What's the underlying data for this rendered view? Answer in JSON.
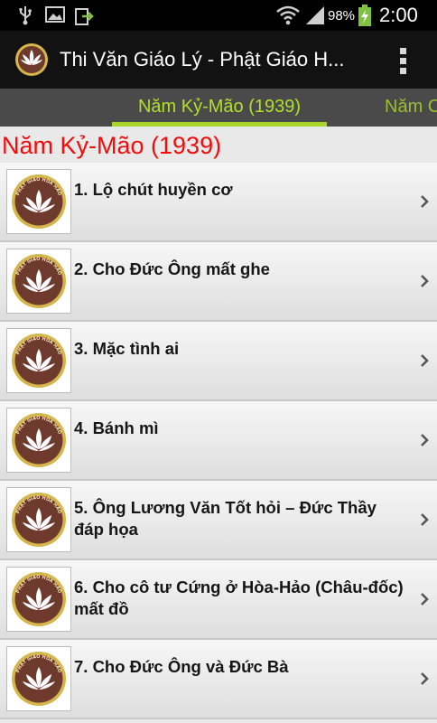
{
  "status_bar": {
    "battery_percent": "98%",
    "time": "2:00"
  },
  "action_bar": {
    "title": "Thi Văn Giáo Lý - Phật Giáo H...",
    "overflow_icon": "overflow-menu-icon"
  },
  "tabs": [
    {
      "label": "Năm Kỷ-Mão (1939)"
    },
    {
      "label": "Năm C"
    }
  ],
  "section": {
    "heading": "Năm Kỷ-Mão (1939)"
  },
  "logo_text": "PHẬT GIÁO HÒA HẢO",
  "items": [
    {
      "title": "1. Lộ chút huyền cơ"
    },
    {
      "title": "2. Cho Đức Ông mất ghe"
    },
    {
      "title": "3. Mặc tình ai"
    },
    {
      "title": "4. Bánh mì"
    },
    {
      "title": "5. Ông Lương Văn Tốt hỏi – Đức Thầy đáp họa"
    },
    {
      "title": "6. Cho cô tư Cứng ở Hòa-Hảo (Châu-đốc) mất đồ"
    },
    {
      "title": "7. Cho Đức Ông và Đức Bà"
    }
  ],
  "colors": {
    "accent_green": "#a8d62b",
    "heading_red": "#f20c0c",
    "logo_brown": "#6e3a2e",
    "logo_gold": "#d6b64a"
  }
}
